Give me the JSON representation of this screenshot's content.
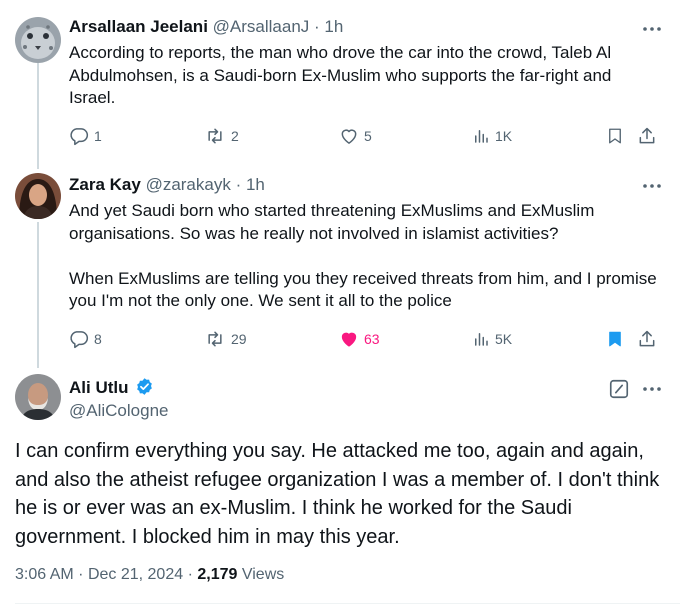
{
  "tweets": [
    {
      "name": "Arsallaan Jeelani",
      "handle": "@ArsallaanJ",
      "time": "· 1h",
      "text": [
        "According to reports, the man who drove the car into the crowd, Taleb Al Abdulmohsen, is a Saudi-born Ex-Muslim who supports the far-right and Israel."
      ],
      "replies": "1",
      "reposts": "2",
      "likes": "5",
      "views": "1K",
      "liked": false,
      "bookmarked": false
    },
    {
      "name": "Zara Kay",
      "handle": "@zarakayk",
      "time": "· 1h",
      "text": [
        "And yet Saudi born who started threatening ExMuslims and ExMuslim organisations. So was he really not involved in islamist activities?",
        "When ExMuslims are telling you they received threats from him, and I promise you I'm not the only one. We sent it all to the police"
      ],
      "replies": "8",
      "reposts": "29",
      "likes": "63",
      "views": "5K",
      "liked": true,
      "bookmarked": true
    }
  ],
  "main_tweet": {
    "name": "Ali Utlu",
    "handle": "@AliCologne",
    "verified": true,
    "text": "I can confirm everything you say. He attacked me too, again and again, and also the atheist refugee organization I was a member of. I don't think he is or ever was an ex-Muslim. I think he worked for the Saudi government. I blocked him in may this year.",
    "time": "3:06 AM",
    "date": "Dec 21, 2024",
    "views_count": "2,179",
    "views_label": "Views"
  },
  "colors": {
    "text": "#0f1419",
    "secondary": "#536471",
    "accent": "#1d9bf0",
    "like": "#f91880",
    "rule": "#cfd9de"
  }
}
